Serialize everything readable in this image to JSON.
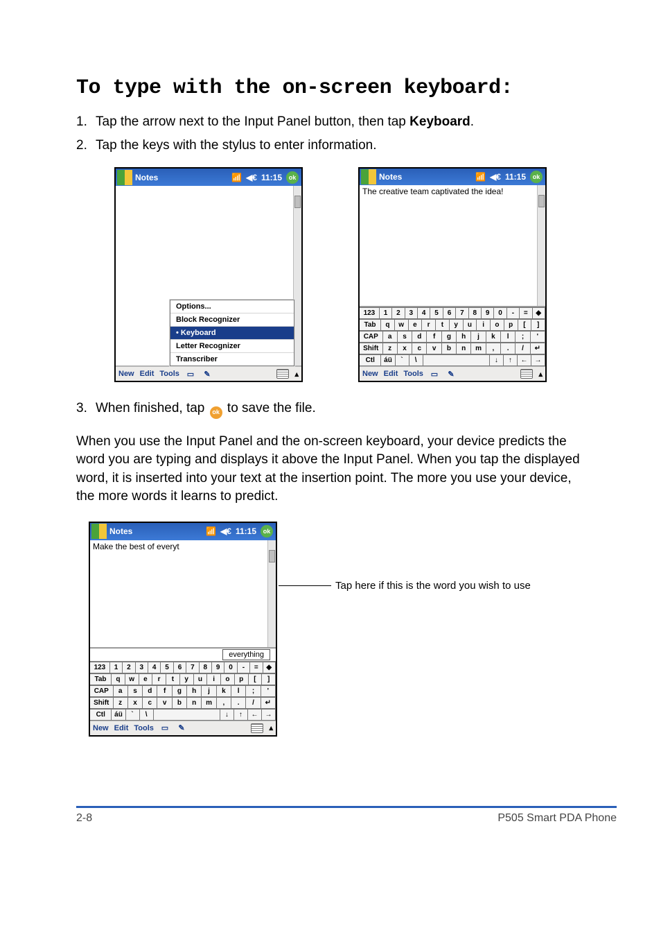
{
  "heading": "To type with the on-screen keyboard:",
  "steps": {
    "s1_num": "1.",
    "s1_a": "Tap the arrow next to the Input Panel button, then tap ",
    "s1_kw": "Keyboard",
    "s1_b": ".",
    "s2_num": "2.",
    "s2": "Tap the keys with the stylus to enter information.",
    "s3_num": "3.",
    "s3_a": "When finished, tap ",
    "s3_ok": "ok",
    "s3_b": " to save the file."
  },
  "pda_common": {
    "title": "Notes",
    "time": "11:15",
    "ok": "ok",
    "toolbar": {
      "new": "New",
      "edit": "Edit",
      "tools": "Tools"
    }
  },
  "pda_left": {
    "popup": {
      "options": "Options...",
      "block": "Block Recognizer",
      "keyboard": "• Keyboard",
      "letter": "Letter Recognizer",
      "transcriber": "Transcriber"
    }
  },
  "pda_right": {
    "typed": "The creative team captivated the idea!"
  },
  "osk": {
    "r1": [
      "123",
      "1",
      "2",
      "3",
      "4",
      "5",
      "6",
      "7",
      "8",
      "9",
      "0",
      "-",
      "=",
      "◆"
    ],
    "r2": [
      "Tab",
      "q",
      "w",
      "e",
      "r",
      "t",
      "y",
      "u",
      "i",
      "o",
      "p",
      "[",
      "]"
    ],
    "r3": [
      "CAP",
      "a",
      "s",
      "d",
      "f",
      "g",
      "h",
      "j",
      "k",
      "l",
      ";",
      "'"
    ],
    "r4": [
      "Shift",
      "z",
      "x",
      "c",
      "v",
      "b",
      "n",
      "m",
      ",",
      ".",
      "/",
      "↵"
    ],
    "r5": [
      "Ctl",
      "áü",
      "`",
      "\\",
      " ",
      "↓",
      "↑",
      "←",
      "→"
    ]
  },
  "paragraph": "When you use the Input Panel and the on-screen keyboard, your device predicts the word you are typing and displays it above the Input Panel. When you tap the displayed word, it is inserted into your text at the insertion point. The more you use your device, the more words it learns to predict.",
  "pda_bottom": {
    "typed": "Make the best of everyt",
    "predicted": "everything"
  },
  "pointer_label": "Tap here if this is the word you wish to use",
  "footer": {
    "left": "2-8",
    "right": "P505 Smart PDA Phone"
  }
}
